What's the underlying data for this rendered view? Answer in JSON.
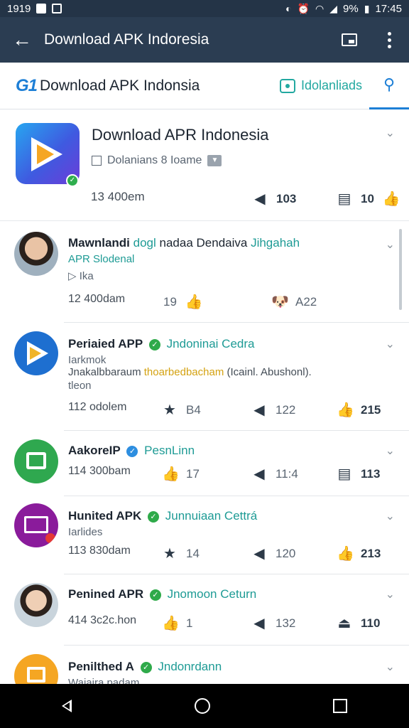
{
  "status": {
    "time": "1919",
    "battery": "9%",
    "clock": "17:45"
  },
  "appbar": {
    "title": "Download APK Indoresia"
  },
  "header": {
    "logo": "G1",
    "site_name": "Download APK Indonsia",
    "downloads_label": "Idolanliads"
  },
  "featured": {
    "title": "Download APR Indonesia",
    "subtitle": "Dolanians  8  Ioame",
    "time": "13 400em",
    "stat1": "103",
    "stat2": "10"
  },
  "posts": [
    {
      "name": "Mawnlandi",
      "tag": "dogl",
      "rest": "nadaa Dendaiva",
      "tag2": "Jihgahah",
      "line2": "APR Slodenal",
      "line3": "▷ Ika",
      "time": "12 400dam",
      "a": "19",
      "b": "A22"
    },
    {
      "name": "Periaied APP",
      "tag": "Jndoninai Cedra",
      "line2": "Iarkmok",
      "line3a": "Jnakalbbaraum ",
      "line3b": "thoarbedbacham",
      "line3c": "  (Icainl. Abushonl).",
      "line4": "tleon",
      "time": "112 odolem",
      "a": "B4",
      "b": "122",
      "c": "215"
    },
    {
      "name": "AakoreIP",
      "tag": "PesnLinn",
      "time": "114 300bam",
      "a": "17",
      "b": "11:4",
      "c": "113"
    },
    {
      "name": "Hunited APK",
      "tag": "Junnuiaan Cettrá",
      "line2": "Iarlides",
      "time": "113 830dam",
      "a": "14",
      "b": "120",
      "c": "213"
    },
    {
      "name": "Penined APR",
      "tag": "Jnomoon Ceturn",
      "time": "414 3c2c.hon",
      "a": "1",
      "b": "132",
      "c": "110"
    },
    {
      "name": "Penilthed A",
      "tag": "Jndonrdann",
      "line2": "Wajaira padam"
    }
  ],
  "icons": {
    "back": "arrow-left-icon",
    "cast": "cast-icon",
    "more": "more-vert-icon",
    "search": "search-icon"
  },
  "colors": {
    "app_bar": "#2b3d52",
    "accent": "#1d7fd6",
    "teal": "#1e9b95",
    "verified": "#2faa4a"
  }
}
